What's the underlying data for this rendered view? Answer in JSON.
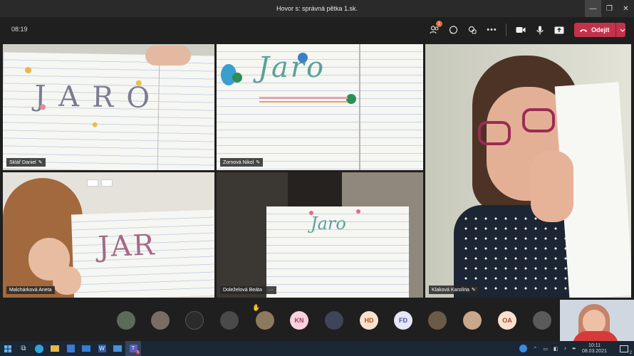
{
  "window": {
    "title": "Hovor s: správná pětka 1.sk."
  },
  "toolbar": {
    "timer": "08:19",
    "participants_badge": "1",
    "leave_label": "Odejít"
  },
  "tiles": [
    {
      "name": "Sklář Daniel",
      "word": "JARO"
    },
    {
      "name": "Zornová Nikol",
      "word": "Jaro"
    },
    {
      "name": "Klaková Karolína"
    },
    {
      "name": "Malchárková Aneta",
      "word": "JAR"
    },
    {
      "name": "Doleželová Beáta",
      "more": "···",
      "word": "Jaro"
    }
  ],
  "strip": {
    "initials": [
      "KN",
      "HD",
      "FD",
      "OA"
    ]
  },
  "taskbar": {
    "time": "10:11",
    "date": "08.03.2021",
    "teams_badge": "5",
    "notif_count": "2"
  },
  "colors": {
    "leave": "#c4314b",
    "taskbar": "#1b2735"
  }
}
